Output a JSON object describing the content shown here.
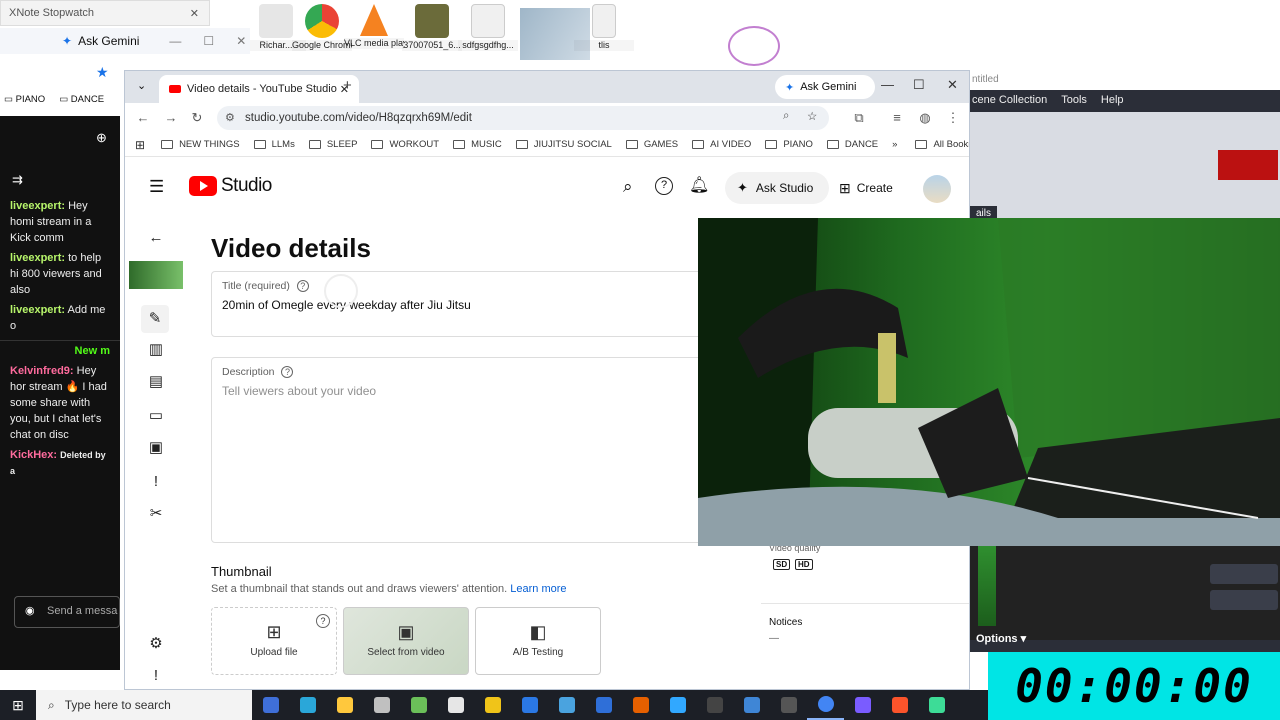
{
  "desktop": {
    "icons": [
      {
        "label": "Richar...",
        "color": "#e6e6e6"
      },
      {
        "label": "Google Chrome",
        "color": "#4285f4"
      },
      {
        "label": "VLC media player",
        "color": "#f58220"
      },
      {
        "label": "37007051_6...",
        "color": "#6b6b3a"
      },
      {
        "label": "sdfgsgdfhg...",
        "color": "#f0f0f0"
      },
      {
        "label": "tlis",
        "color": "#f0f0f0"
      }
    ],
    "xnote_title": "XNote Stopwatch"
  },
  "left_window": {
    "ask_gemini": "Ask Gemini",
    "chat": [
      {
        "user": "liveexpert:",
        "user_color": "#b7f56b",
        "text": "Hey homi stream in a Kick comm"
      },
      {
        "user": "liveexpert:",
        "user_color": "#b7f56b",
        "text": "to help hi 800 viewers and also"
      },
      {
        "user": "liveexpert:",
        "user_color": "#b7f56b",
        "text": "Add me o"
      },
      {
        "user": "",
        "user_color": "#53fc18",
        "text": "New m"
      },
      {
        "user": "Kelvinfred9:",
        "user_color": "#ff6b9d",
        "text": "Hey hor stream 🔥 I had some share with you, but I chat let's chat on disc"
      },
      {
        "user": "KickHex:",
        "user_color": "#ff6b9d",
        "text": "Deleted by a"
      }
    ],
    "chat_placeholder": "Send a messa"
  },
  "right_window": {
    "title": "ntitled",
    "menu": [
      "cene Collection",
      "Tools",
      "Help"
    ],
    "tab_label": "ails",
    "options_label": "Options",
    "stopwatch": "00:00:00"
  },
  "chrome": {
    "tab_title": "Video details - YouTube Studio",
    "ask_gemini": "Ask Gemini",
    "url": "studio.youtube.com/video/H8qzqrxh69M/edit",
    "bookmarks": [
      "NEW THINGS",
      "LLMs",
      "SLEEP",
      "WORKOUT",
      "MUSIC",
      "JIUJITSU SOCIAL",
      "GAMES",
      "AI VIDEO",
      "PIANO",
      "DANCE"
    ],
    "all_bookmarks": "All Bookmarks"
  },
  "studio": {
    "logo_text": "Studio",
    "ask_studio": "Ask Studio",
    "create": "Create",
    "page_title": "Video details",
    "title_label": "Title (required)",
    "title_value": "20min of Omegle every weekday after Jiu Jitsu",
    "description_label": "Description",
    "description_placeholder": "Tell viewers about your video",
    "thumbnail_title": "Thumbnail",
    "thumbnail_hint": "Set a thumbnail that stands out and draws viewers' attention.",
    "learn_more": "Learn more",
    "thumb_options": [
      "Upload file",
      "Select from video",
      "A/B Testing"
    ],
    "video_quality": "Video quality",
    "quality_badges": [
      "SD",
      "HD"
    ],
    "notices": "Notices",
    "notices_value": "—"
  },
  "taskbar": {
    "search_placeholder": "Type here to search",
    "apps": [
      "#3f6fd8",
      "#2aa7d9",
      "#ffc83d",
      "#c0c0c0",
      "#6bbf59",
      "#e6e6e6",
      "#f0c419",
      "#2b78e4",
      "#4aa3df",
      "#2f6fd8",
      "#e66000",
      "#31a8ff",
      "#444",
      "#3f86d6",
      "#555",
      "#4285f4",
      "#7a5cff",
      "#fb542b",
      "#3ddc97"
    ]
  }
}
